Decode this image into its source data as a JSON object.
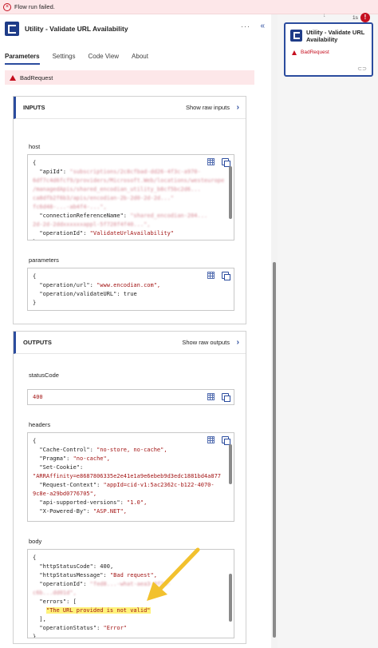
{
  "banner": {
    "message": "Flow run failed."
  },
  "panel": {
    "title": "Utility - Validate URL Availability",
    "more": "···",
    "collapse": "«",
    "tabs": [
      "Parameters",
      "Settings",
      "Code View",
      "About"
    ],
    "error": "BadRequest"
  },
  "inputs": {
    "label": "INPUTS",
    "raw_link": "Show raw inputs",
    "host_label": "host",
    "host_lines": [
      {
        "k": "{",
        "v": ""
      },
      {
        "k": "  \"apiId\": ",
        "v": "\"subscriptions/2c8cfbad-dd26-4f3c-a970-",
        "blur": true
      },
      {
        "k": "",
        "v": "6df7c4d6fcf9/providers/Microsoft.Web/locations/westeurope",
        "blur": true
      },
      {
        "k": "",
        "v": "/managedApis/shared_encodian_utility_b8cf5bc2d6...",
        "blur": true
      },
      {
        "k": "",
        "v": "ca8dfb2f6b3/apis/encodian-2b-2d0-2d-2d...\"",
        "blur": true
      },
      {
        "k": "",
        "v": "fc6d48-...-ab4f4-...\",",
        "blur": true
      },
      {
        "k": "  \"connectionReferenceName\": ",
        "v": "\"shared_encodian-204...",
        "blur": true
      },
      {
        "k": "",
        "v": "2d-2d-2ddxxxxxxappl-5f728f4f40...\",",
        "blur": true
      },
      {
        "k": "  \"operationId\": ",
        "v": "\"ValidateUrlAvailability\""
      },
      {
        "k": "}",
        "v": ""
      }
    ],
    "params_label": "parameters",
    "params_lines": [
      {
        "k": "{",
        "v": ""
      },
      {
        "k": "  \"operation/url\": ",
        "v": "\"www.encodian.com\","
      },
      {
        "k": "  \"operation/validateURL\": ",
        "v": "true",
        "plain": true
      },
      {
        "k": "}",
        "v": ""
      }
    ]
  },
  "outputs": {
    "label": "OUTPUTS",
    "raw_link": "Show raw outputs",
    "status_label": "statusCode",
    "status_value": "400",
    "headers_label": "headers",
    "headers_lines": [
      {
        "k": "{",
        "v": ""
      },
      {
        "k": "  \"Cache-Control\": ",
        "v": "\"no-store, no-cache\","
      },
      {
        "k": "  \"Pragma\": ",
        "v": "\"no-cache\","
      },
      {
        "k": "  \"Set-Cookie\": ",
        "v": ""
      },
      {
        "k": "",
        "v": "\"ARRAffinity=e8687806335e2e41e1a9e6ebeb9d3edc1881bd4a877"
      },
      {
        "k": "  \"Request-Context\": ",
        "v": "\"appId=cid-v1:5ac2362c-b122-4070-"
      },
      {
        "k": "",
        "v": "9c8e-a29bd0776705\","
      },
      {
        "k": "  \"api-supported-versions\": ",
        "v": "\"1.0\","
      },
      {
        "k": "  \"X-Powered-By\": ",
        "v": "\"ASP.NET\","
      }
    ],
    "body_label": "body",
    "body_lines": [
      {
        "k": "{",
        "v": ""
      },
      {
        "k": "  \"httpStatusCode\": ",
        "v": "400,",
        "plain": true
      },
      {
        "k": "  \"httpStatusMessage\": ",
        "v": "\"Bad request\","
      },
      {
        "k": "  \"operationId\": ",
        "v": "\"fed8...-what-aea3-8f24-",
        "blur": true
      },
      {
        "k": "",
        "v": "c6b...dd01d\",",
        "blur": true
      },
      {
        "k": "  \"errors\": [",
        "v": ""
      },
      {
        "k": "    ",
        "v": "\"The URL provided is not valid\"",
        "hl": true
      },
      {
        "k": "  ],",
        "v": ""
      },
      {
        "k": "  \"operationStatus\": ",
        "v": "\"Error\""
      },
      {
        "k": "}",
        "v": ""
      }
    ]
  },
  "node": {
    "title": "Utility - Validate URL Availability",
    "status": "BadRequest",
    "duration": "1s",
    "error_badge": "!"
  },
  "colors": {
    "accent": "#2b4c9e",
    "error": "#c50f1f",
    "highlight": "#fff27a",
    "annotation_arrow": "#f2c12e"
  }
}
